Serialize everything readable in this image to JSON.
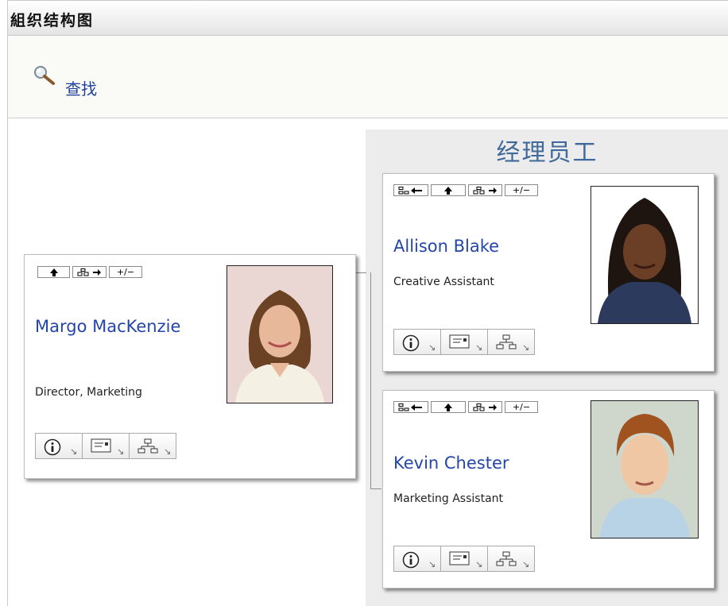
{
  "window": {
    "title": "組织结构图"
  },
  "toolbar": {
    "find_label": "查找"
  },
  "peers": {
    "header": "经理员工"
  },
  "colors": {
    "link": "#2346a8",
    "header": "#3f6a9a",
    "panel": "#ececec"
  },
  "icons": {
    "move_up": "up-arrow-icon",
    "expand": "org-expand-icon",
    "toggle": "+/−",
    "back": "org-back-icon",
    "info": "info-icon",
    "card": "business-card-icon",
    "orgchart": "org-chart-icon"
  },
  "manager": {
    "name": "Margo MacKenzie",
    "title": "Director, Marketing",
    "toggle_label": "+/−"
  },
  "employees": [
    {
      "name": "Allison Blake",
      "title": "Creative Assistant",
      "toggle_label": "+/−"
    },
    {
      "name": "Kevin Chester",
      "title": "Marketing Assistant",
      "toggle_label": "+/−"
    }
  ]
}
